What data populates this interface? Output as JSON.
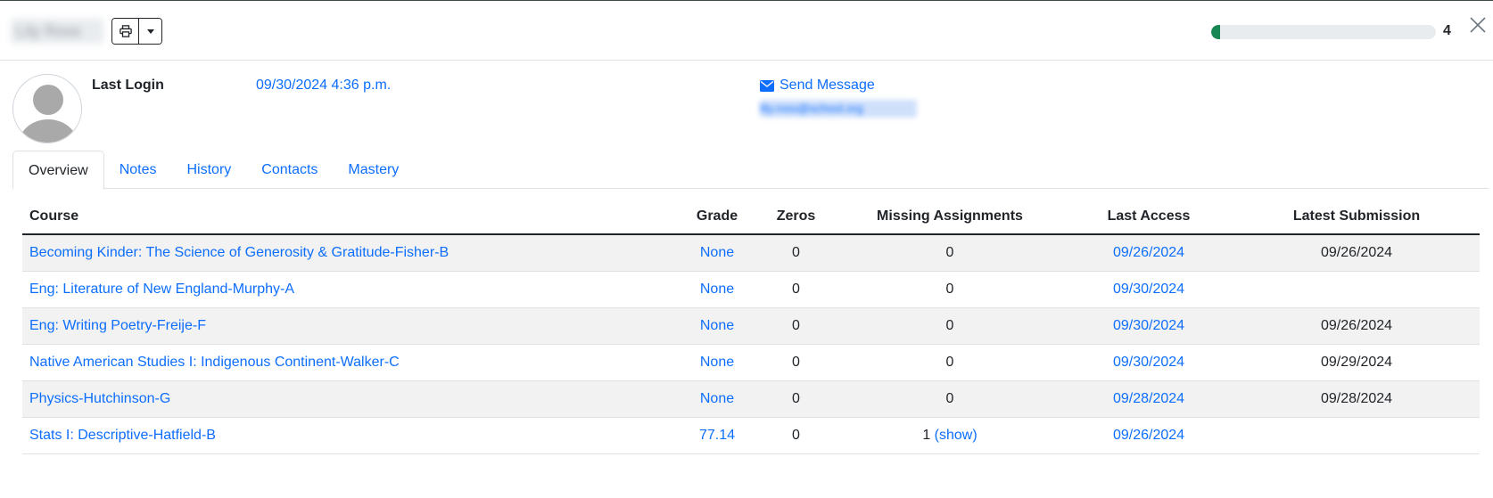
{
  "header": {
    "student_name": "Lily Ross",
    "progress": {
      "value": 0.04,
      "count": "4",
      "color": "#198754"
    }
  },
  "profile": {
    "last_login_label": "Last Login",
    "last_login_value": "09/30/2024 4:36 p.m.",
    "send_message_label": "Send Message",
    "email": "lily.ross@school.org"
  },
  "tabs": [
    {
      "label": "Overview",
      "active": true
    },
    {
      "label": "Notes"
    },
    {
      "label": "History"
    },
    {
      "label": "Contacts"
    },
    {
      "label": "Mastery"
    }
  ],
  "table": {
    "columns": [
      "Course",
      "Grade",
      "Zeros",
      "Missing Assignments",
      "Last Access",
      "Latest Submission"
    ],
    "rows": [
      {
        "course": "Becoming Kinder: The Science of Generosity & Gratitude-Fisher-B",
        "grade": "None",
        "zeros": "0",
        "missing": "0",
        "missing_link": "",
        "last_access": "09/26/2024",
        "latest_submission": "09/26/2024"
      },
      {
        "course": "Eng: Literature of New England-Murphy-A",
        "grade": "None",
        "zeros": "0",
        "missing": "0",
        "missing_link": "",
        "last_access": "09/30/2024",
        "latest_submission": ""
      },
      {
        "course": "Eng: Writing Poetry-Freije-F",
        "grade": "None",
        "zeros": "0",
        "missing": "0",
        "missing_link": "",
        "last_access": "09/30/2024",
        "latest_submission": "09/26/2024"
      },
      {
        "course": "Native American Studies I: Indigenous Continent-Walker-C",
        "grade": "None",
        "zeros": "0",
        "missing": "0",
        "missing_link": "",
        "last_access": "09/30/2024",
        "latest_submission": "09/29/2024"
      },
      {
        "course": "Physics-Hutchinson-G",
        "grade": "None",
        "zeros": "0",
        "missing": "0",
        "missing_link": "",
        "last_access": "09/28/2024",
        "latest_submission": "09/28/2024"
      },
      {
        "course": "Stats I: Descriptive-Hatfield-B",
        "grade": "77.14",
        "zeros": "0",
        "missing": "1",
        "missing_link": "(show)",
        "last_access": "09/26/2024",
        "latest_submission": ""
      }
    ]
  },
  "colors": {
    "link": "#0d6efd",
    "text": "#212529",
    "stripe": "#f2f2f2"
  },
  "icons": [
    "print-icon",
    "caret-down-icon",
    "close-icon",
    "envelope-icon",
    "avatar-placeholder-icon"
  ]
}
